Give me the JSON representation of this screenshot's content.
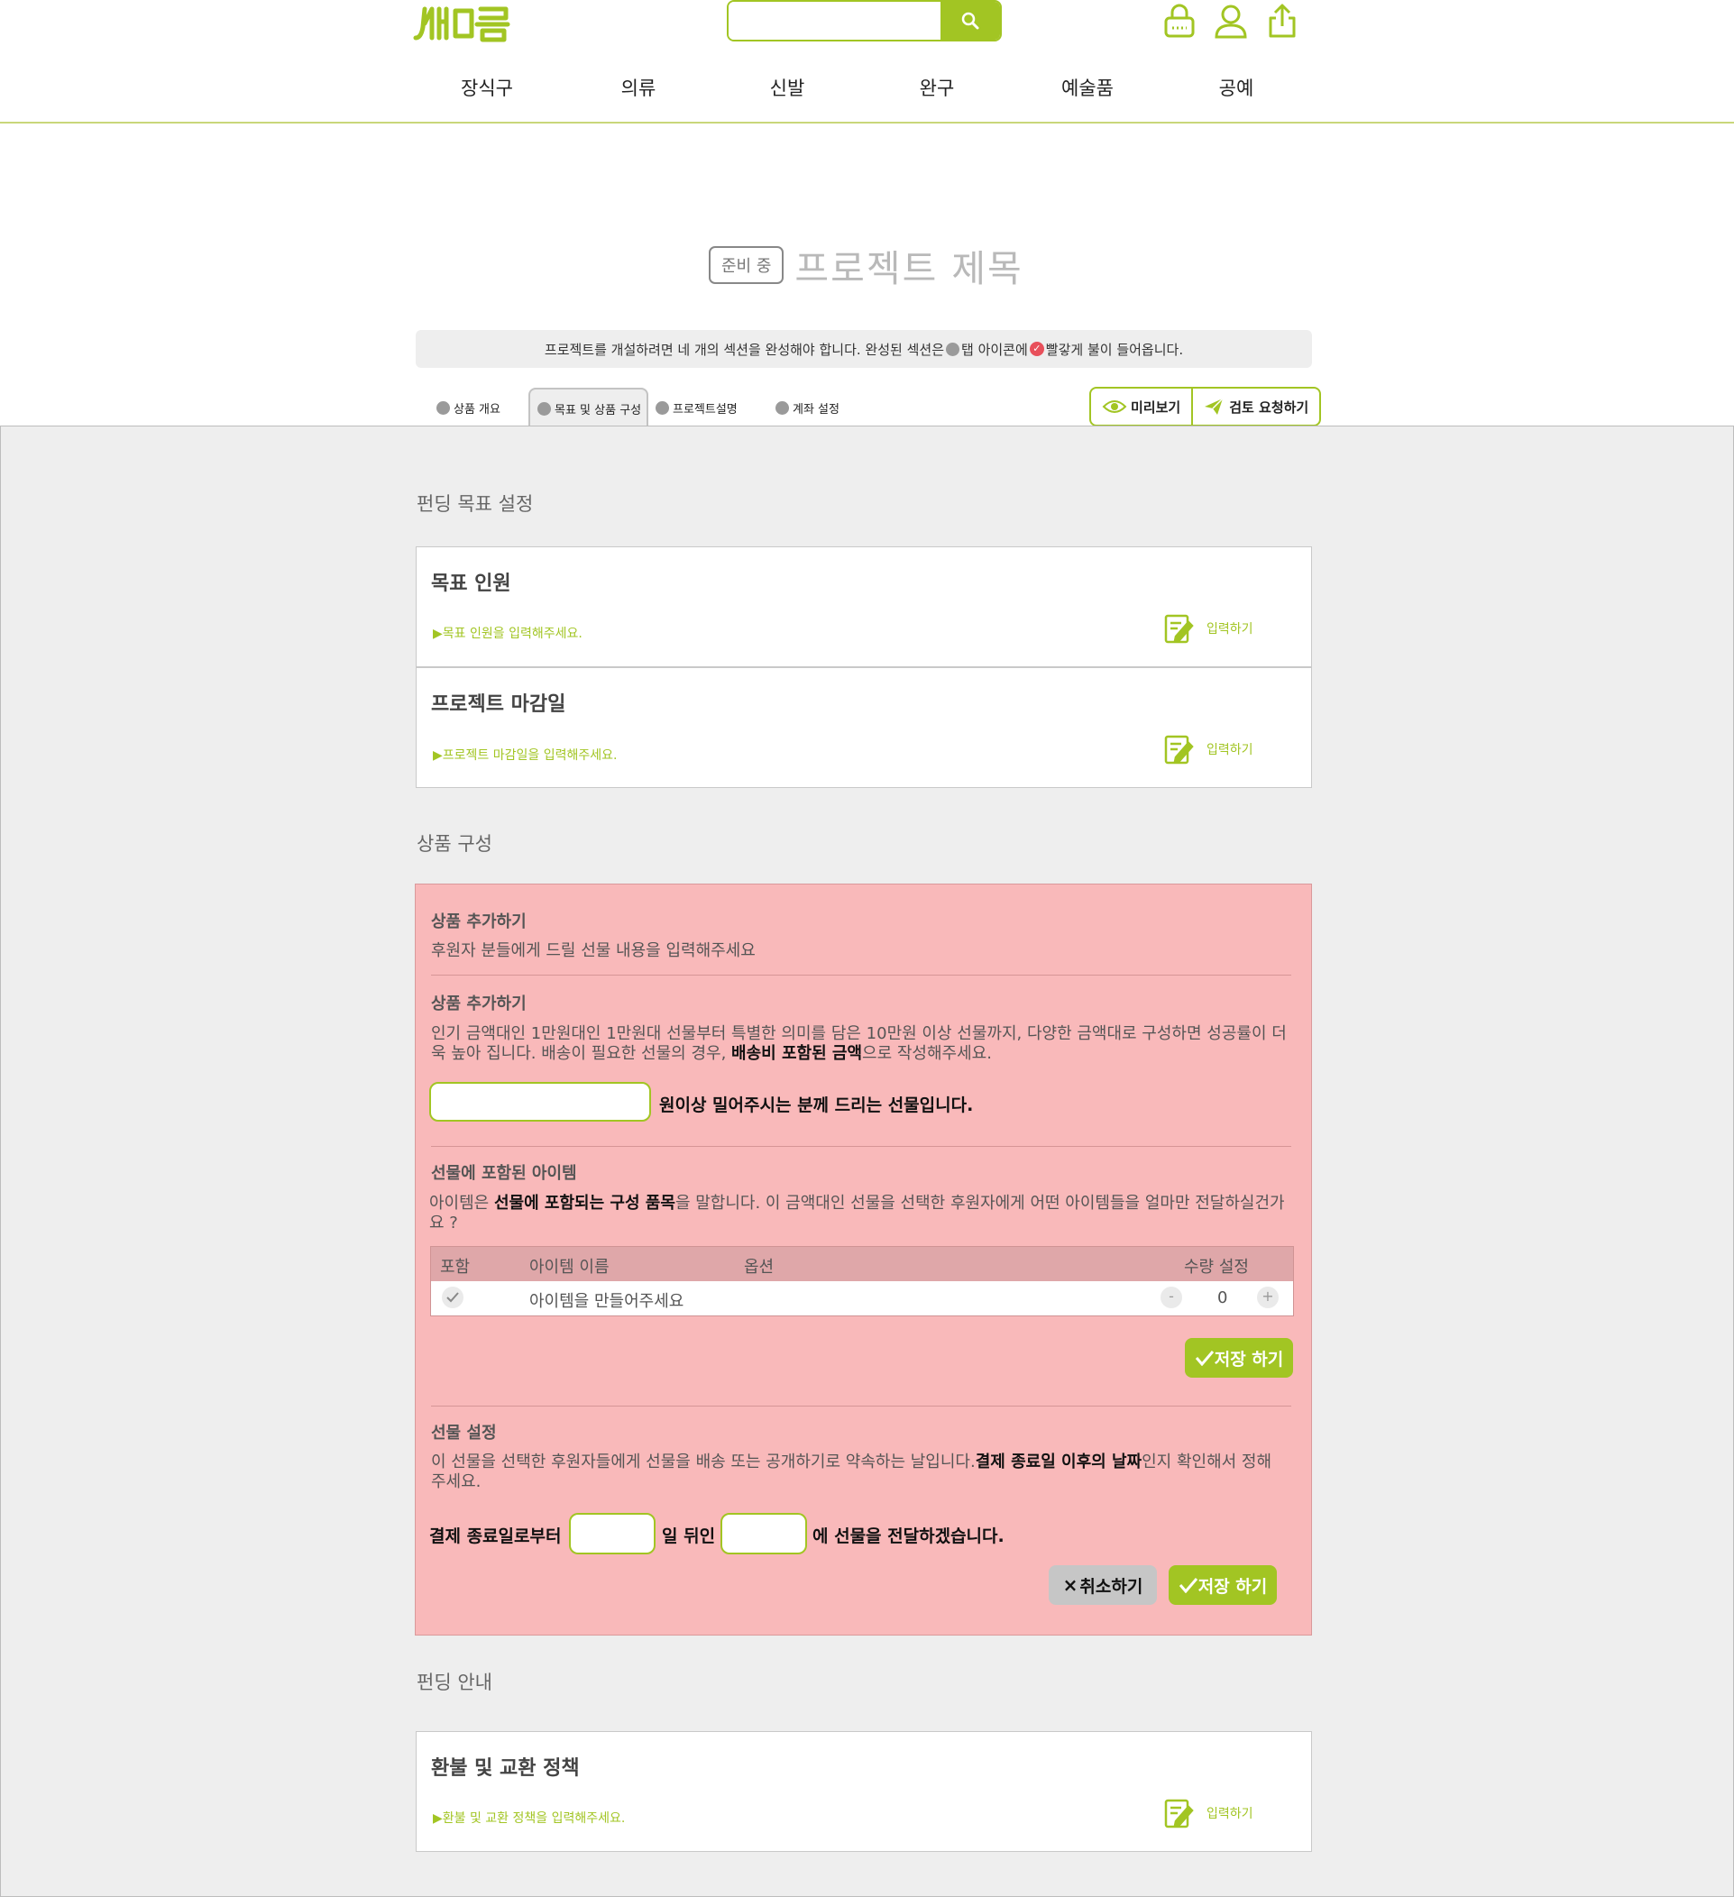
{
  "header": {
    "logo_text": "새미음",
    "search": {
      "value": "",
      "placeholder": ""
    },
    "nav": [
      "장식구",
      "의류",
      "신발",
      "완구",
      "예술품",
      "공예"
    ]
  },
  "project": {
    "status_badge": "준비 중",
    "title": "프로젝트 제목",
    "notice": {
      "part1": "프로젝트를 개설하려면 네 개의 섹션을 완성해야 합니다. 완성된 섹션은",
      "part2": " 탭 아이콘에 ",
      "part3": "빨갛게 불이 들어옵니다."
    },
    "tabs": [
      "상품 개요",
      "목표 및 상품 구성",
      "프로젝트설명",
      "계좌 설정"
    ],
    "preview_label": "미리보기",
    "review_label": "검토 요청하기"
  },
  "funding_goal": {
    "section_title": "펀딩 목표 설정",
    "cards": [
      {
        "heading": "목표 인원",
        "hint": "▶목표 인원을 입력해주세요.",
        "enter_label": "입력하기"
      },
      {
        "heading": "프로젝트 마감일",
        "hint": "▶프로젝트 마감일을 입력해주세요.",
        "enter_label": "입력하기"
      }
    ]
  },
  "product": {
    "section_title": "상품 구성",
    "add_heading": "상품 추가하기",
    "add_desc": "후원자 분들에게 드릴 선물 내용을 입력해주세요",
    "add_heading2": "상품 추가하기",
    "add_desc2_a": "인기 금액대인 1만원대인 1만원대 선물부터 특별한 의미를 담은 10만원 이상 선물까지, 다양한 금액대로 구성하면 성공률이 더욱 높아 집니다. 배송이 필요한 선물의 경우, ",
    "add_desc2_b": "배송비 포함된 금액",
    "add_desc2_c": "으로 작성해주세요.",
    "amount_value": "",
    "amount_suffix": "원이상 밀어주시는 분께 드리는 선물입니다.",
    "items_heading": "선물에 포함된 아이템",
    "items_desc_a": "아이템은 ",
    "items_desc_b": "선물에 포함되는 구성 품목",
    "items_desc_c": "을 말합니다. 이 금액대인 선물을 선택한 후원자에게 어떤 아이템들을 얼마만 전달하실건가요 ?",
    "table_headers": [
      "포함",
      "아이템 이름",
      "옵션",
      "수량 설정"
    ],
    "table_row": {
      "name": "아이템을 만들어주세요",
      "quantity": "0",
      "minus": "-",
      "plus": "+"
    },
    "save_label": "저장 하기",
    "gift_heading": "선물 설정",
    "gift_desc_a": "이 선물을 선택한 후원자들에게 선물을 배송 또는 공개하기로 약속하는 날입니다.",
    "gift_desc_b": "결제 종료일 이후의 날짜",
    "gift_desc_c": "인지 확인해서 정해주세요.",
    "gift_prefix": "결제 종료일로부터",
    "gift_days_value": "",
    "gift_mid": "일 뒤인",
    "gift_date_value": "",
    "gift_suffix": "에 선물을 전달하겠습니다.",
    "cancel_label": "취소하기",
    "save_label2": "저장 하기"
  },
  "funding_info": {
    "section_title": "펀딩 안내",
    "card": {
      "heading": "환불 및 교환 정책",
      "hint": "▶환불 및 교환 정책을 입력해주세요.",
      "enter_label": "입력하기"
    }
  },
  "colors": {
    "accent": "#a2c523",
    "pink_panel": "#f9b9ba",
    "badge_red": "#e8505b",
    "page_grey": "#eeeeee"
  }
}
